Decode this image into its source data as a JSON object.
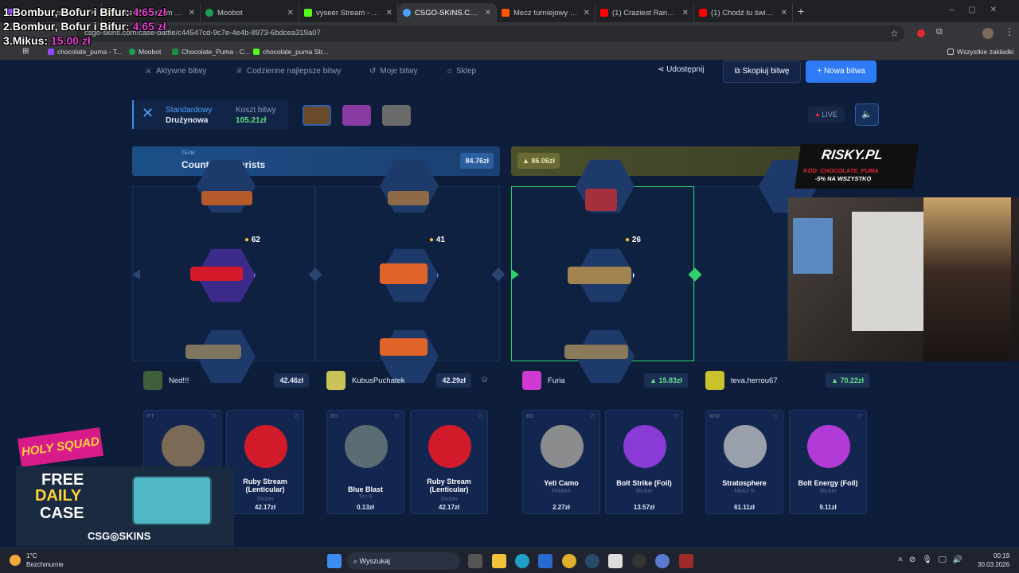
{
  "browser": {
    "tabs": [
      {
        "title": "chocolate_puma Stre",
        "color": "#9146ff"
      },
      {
        "title": "furia475 Stream - Wa",
        "color": "#53fc18"
      },
      {
        "title": "Moobot",
        "color": "#1aa052"
      },
      {
        "title": "vyseer Stream - Watc",
        "color": "#53fc18"
      },
      {
        "title": "CSGO-SKINS.COM",
        "color": "#4aa3ff"
      },
      {
        "title": "Mecz turniejowy FAC",
        "color": "#ff5500"
      },
      {
        "title": "(1) Craziest Random",
        "color": "#ff0000"
      },
      {
        "title": "(1) Chodź tu świnko",
        "color": "#ff0000"
      }
    ],
    "url": "csgo-skins.com/case-battle/c44547cd-9c7e-4e4b-8973-6bdcea319a07",
    "bookmarks": [
      "chocolate_puma - T...",
      "Moobot",
      "Chocolate_Puma - C...",
      "chocolate_puma Str..."
    ],
    "bookmarks_right": "Wszystkie zakładki"
  },
  "leaderboard": [
    {
      "rank": "1.",
      "name": "Bombur, Bofur i Bifur:",
      "amount": "4.65 zł"
    },
    {
      "rank": "2.",
      "name": "Bombur, Bofur i Bifur:",
      "amount": "4.65 zł"
    },
    {
      "rank": "3.",
      "name": "Mikus:",
      "amount": "15.00 zł"
    }
  ],
  "nav": {
    "active_battles": "Aktywne bitwy",
    "daily_best": "Codzienne najlepsze bitwy",
    "my_battles": "Moje bitwy",
    "shop": "Sklep",
    "share": "Udostępnij",
    "copy": "Skopiuj bitwę",
    "new_battle": "+ Nowa bitwa"
  },
  "mode": {
    "type": "Standardowy",
    "sub": "Drużynowa",
    "cost_label": "Koszt bitwy",
    "cost": "105.21zł"
  },
  "live": "LIVE",
  "teams": {
    "left": {
      "label": "TEAM",
      "name": "Counter-Terrorists",
      "value": "84.76zł"
    },
    "right": {
      "value": "▲ 86.06zł",
      "name_partial": "Te"
    }
  },
  "slots": [
    {
      "coins": "62"
    },
    {
      "coins": "41"
    },
    {
      "coins": "26"
    },
    {
      "coins": ""
    }
  ],
  "players": [
    {
      "name": "Ned!!!",
      "value": "42.46zł"
    },
    {
      "name": "KubusPuchatek",
      "value": "42.29zł"
    },
    {
      "name": "Furia",
      "value": "▲ 15.83zł"
    },
    {
      "name": "teva.herrou67",
      "value": "▲ 70.22zł"
    }
  ],
  "cards": [
    {
      "tag": "FT",
      "name": "",
      "sub": "",
      "price": "",
      "color": "#7b6a55"
    },
    {
      "tag": "",
      "name": "Ruby Stream (Lenticular)",
      "sub": "Sticker",
      "price": "42.17zł",
      "color": "#d11a2a"
    },
    {
      "tag": "BS",
      "name": "Blue Blast",
      "sub": "Tec-9",
      "price": "0.13zł",
      "color": "#5b6c72"
    },
    {
      "tag": "",
      "name": "Ruby Stream (Lenticular)",
      "sub": "Sticker",
      "price": "42.17zł",
      "color": "#d11a2a"
    },
    {
      "tag": "BS",
      "name": "Yeti Camo",
      "sub": "FAMAS",
      "price": "2.27zł",
      "color": "#8a8c8e"
    },
    {
      "tag": "",
      "name": "Bolt Strike (Foil)",
      "sub": "Sticker",
      "price": "13.57zł",
      "color": "#8a3bd6"
    },
    {
      "tag": "WW",
      "name": "Stratosphere",
      "sub": "M4A1-S",
      "price": "61.11zł",
      "color": "#9aa0aa"
    },
    {
      "tag": "",
      "name": "Bolt Energy (Foil)",
      "sub": "Sticker",
      "price": "9.11zł",
      "color": "#b23ad6"
    }
  ],
  "risky": {
    "brand": "RISKY.PL",
    "code": "KOD: CHOCOLATE_PUMA",
    "promo": "-5% NA WSZYSTKO"
  },
  "ad": {
    "brand": "HOLY SQUAD",
    "line1": "FREE",
    "line2": "DAILY",
    "line3": "CASE",
    "footer": "CSG◎SKINS"
  },
  "taskbar": {
    "temp": "1°C",
    "weather": "Bezchmurnie",
    "search": "Wyszukaj",
    "time": "00:19",
    "date": "30.03.2026"
  }
}
